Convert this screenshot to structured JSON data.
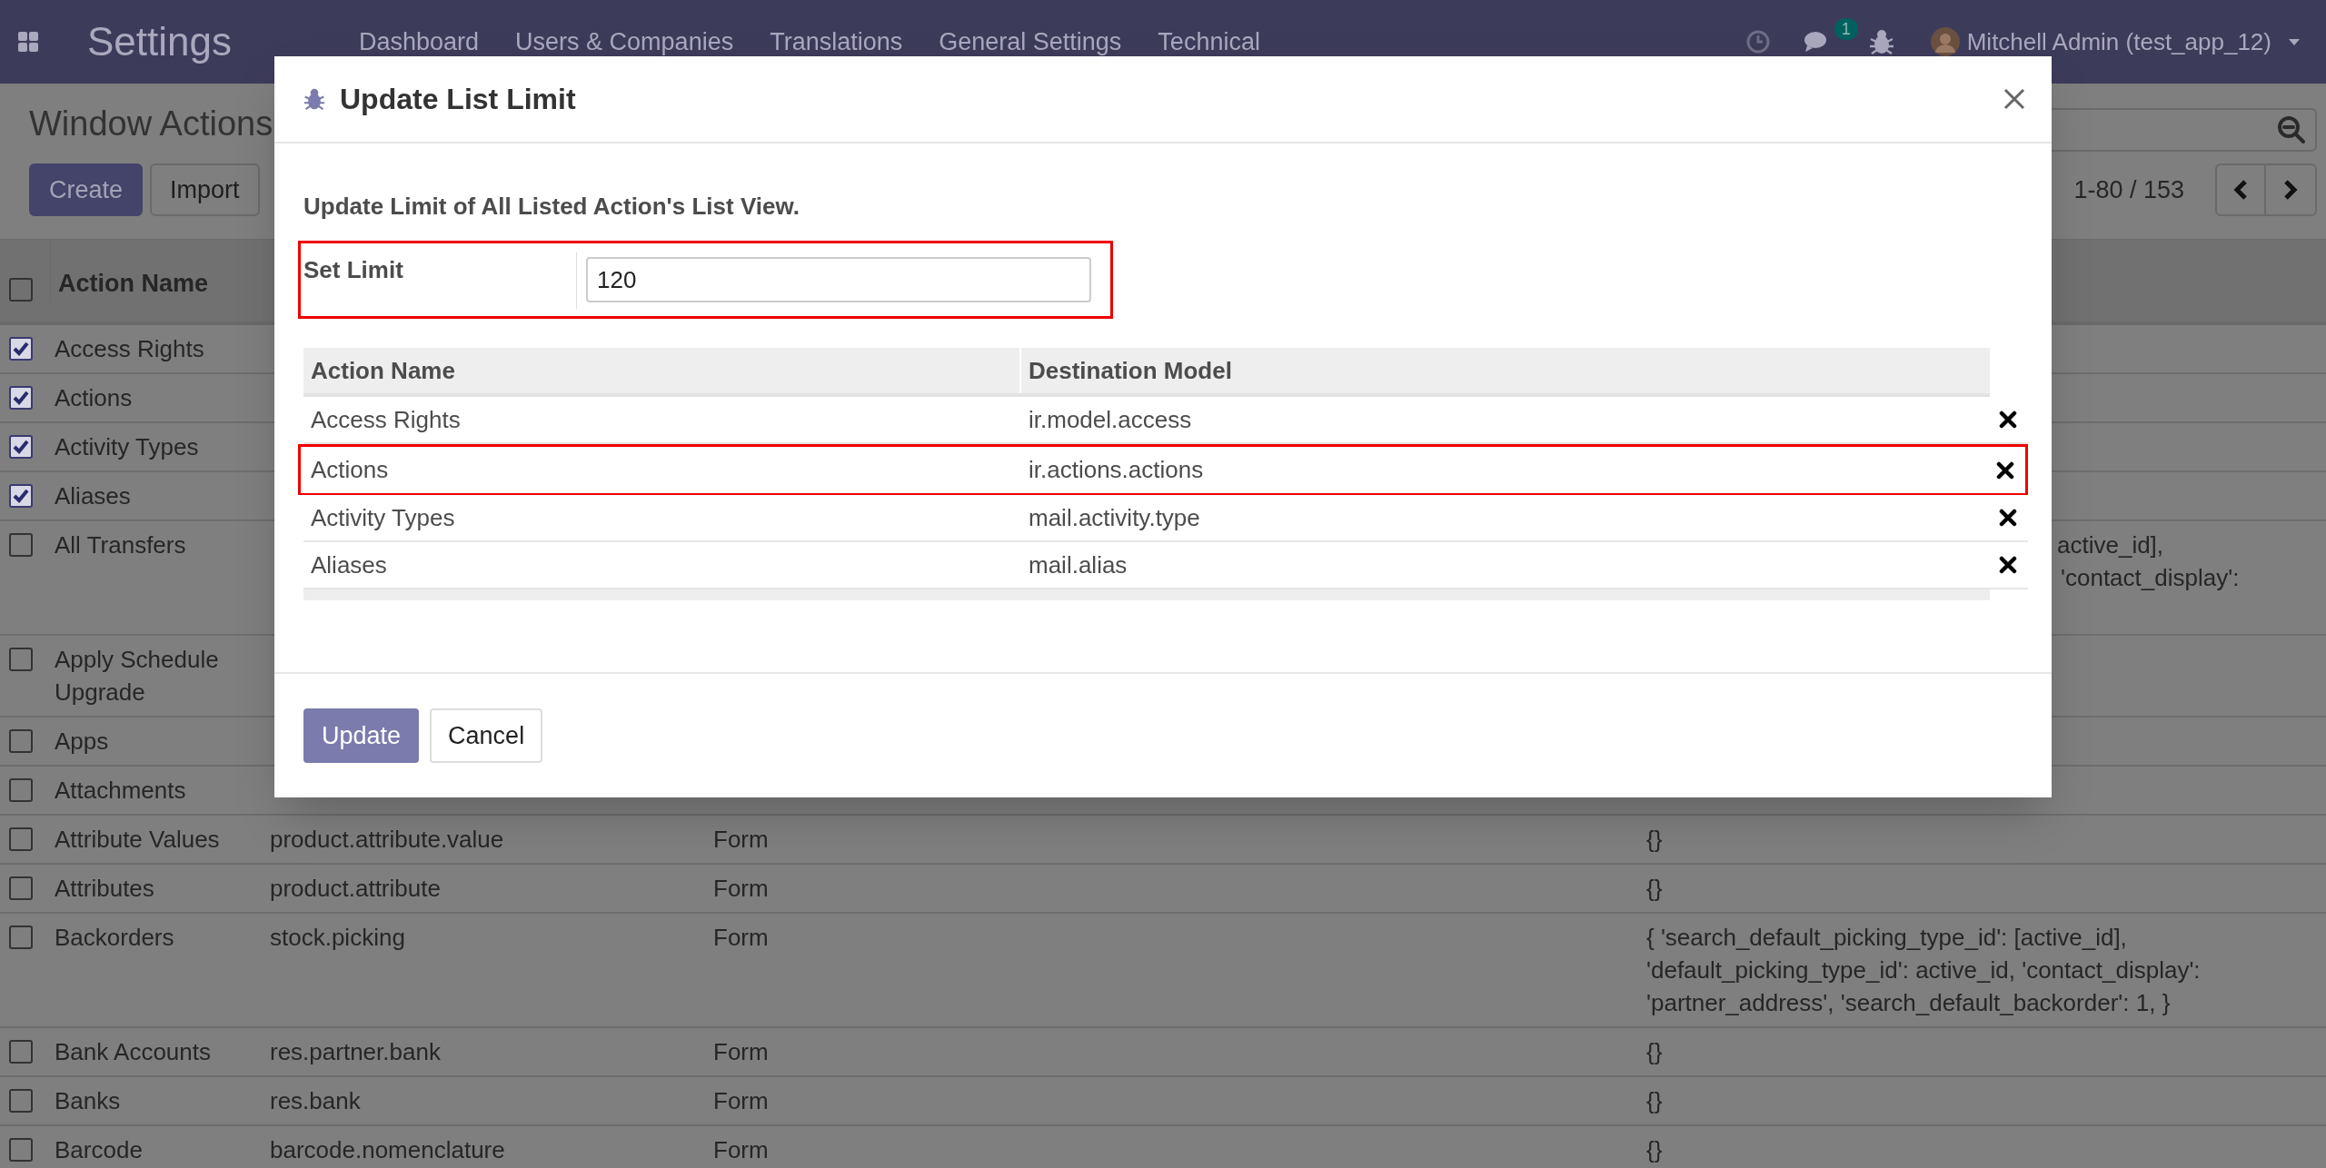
{
  "navbar": {
    "app_title": "Settings",
    "menu": [
      "Dashboard",
      "Users & Companies",
      "Translations",
      "General Settings",
      "Technical"
    ],
    "chat_count": "1",
    "user": "Mitchell Admin (test_app_12)"
  },
  "control_panel": {
    "title": "Window Actions",
    "buttons": [
      {
        "label": "Create",
        "kind": "primary"
      },
      {
        "label": "Import",
        "kind": "secondary"
      }
    ],
    "pager": "1-80 / 153"
  },
  "list": {
    "columns": [
      "Action Name"
    ],
    "header_checked": false,
    "rows": [
      {
        "name": "Access Rights",
        "checked": true
      },
      {
        "name": "Actions",
        "checked": true
      },
      {
        "name": "Activity Types",
        "checked": true
      },
      {
        "name": "Aliases",
        "checked": true
      },
      {
        "name": "All Transfers",
        "checked": false,
        "context_tail": [
          "active_id],",
          "'contact_display':"
        ]
      },
      {
        "name": "Apply Schedule Upgrade",
        "checked": false
      },
      {
        "name": "Apps",
        "checked": false
      },
      {
        "name": "Attachments",
        "checked": false
      },
      {
        "name": "Attribute Values",
        "checked": false,
        "model": "product.attribute.value",
        "view": "Form",
        "context": "{}"
      },
      {
        "name": "Attributes",
        "checked": false,
        "model": "product.attribute",
        "view": "Form",
        "context": "{}"
      },
      {
        "name": "Backorders",
        "checked": false,
        "model": "stock.picking",
        "view": "Form",
        "context": "{ 'search_default_picking_type_id': [active_id], 'default_picking_type_id': active_id, 'contact_display': 'partner_address', 'search_default_backorder': 1, }"
      },
      {
        "name": "Bank Accounts",
        "checked": false,
        "model": "res.partner.bank",
        "view": "Form",
        "context": "{}"
      },
      {
        "name": "Banks",
        "checked": false,
        "model": "res.bank",
        "view": "Form",
        "context": "{}"
      },
      {
        "name": "Barcode",
        "checked": false,
        "model": "barcode.nomenclature",
        "view": "Form",
        "context": "{}"
      }
    ]
  },
  "dialog": {
    "title": "Update List Limit",
    "intro": "Update Limit of All Listed Action's List View.",
    "field": {
      "label": "Set Limit",
      "value": "120",
      "highlighted": true
    },
    "table": {
      "columns": [
        "Action Name",
        "Destination Model"
      ],
      "rows": [
        {
          "name": "Access Rights",
          "model": "ir.model.access",
          "highlighted": false
        },
        {
          "name": "Actions",
          "model": "ir.actions.actions",
          "highlighted": true
        },
        {
          "name": "Activity Types",
          "model": "mail.activity.type",
          "highlighted": false
        },
        {
          "name": "Aliases",
          "model": "mail.alias",
          "highlighted": false
        }
      ]
    },
    "buttons": [
      {
        "label": "Update",
        "kind": "primary"
      },
      {
        "label": "Cancel",
        "kind": "secondary"
      }
    ]
  }
}
